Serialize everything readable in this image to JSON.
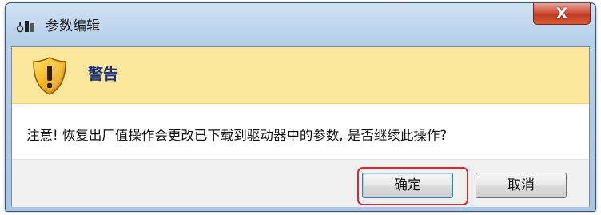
{
  "window": {
    "title": "参数编辑",
    "close_label": "X"
  },
  "header": {
    "title": "警告",
    "icon": "warning-shield-icon"
  },
  "message": "注意! 恢复出厂值操作会更改已下载到驱动器中的参数, 是否继续此操作?",
  "buttons": {
    "ok_label": "确定",
    "cancel_label": "取消"
  },
  "colors": {
    "header_bg": "#fbe79c",
    "header_text": "#1d2f75",
    "highlight": "#e0262e",
    "close_button": "#c23a22"
  }
}
